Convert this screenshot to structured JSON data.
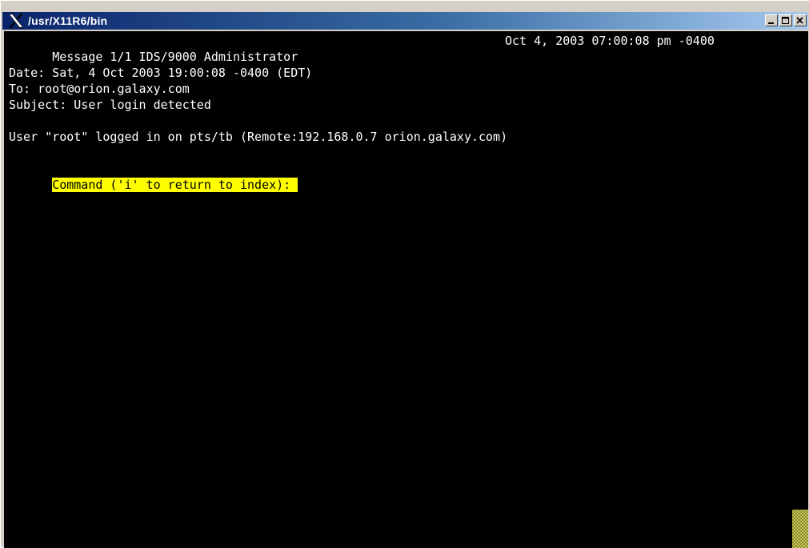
{
  "window": {
    "title": "/usr/X11R6/bin",
    "app_icon": "x11-logo-icon",
    "controls": [
      "minimize-icon",
      "maximize-icon",
      "close-icon"
    ]
  },
  "terminal": {
    "header_left": "Message 1/1 IDS/9000 Administrator",
    "header_right": "Oct 4, 2003 07:00:08 pm -0400",
    "date_line": "Date: Sat, 4 Oct 2003 19:00:08 -0400 (EDT)",
    "to_line": "To: root@orion.galaxy.com",
    "subject_line": "Subject: User login detected",
    "body_line": "User \"root\" logged in on pts/tb (Remote:192.168.0.7 orion.galaxy.com)",
    "command_prompt": "Command ('i' to return to index): "
  },
  "colors": {
    "terminal_bg": "#000000",
    "terminal_fg": "#ffffff",
    "prompt_highlight": "#ffff00",
    "titlebar_start": "#0a246a",
    "titlebar_end": "#a6caf0"
  }
}
